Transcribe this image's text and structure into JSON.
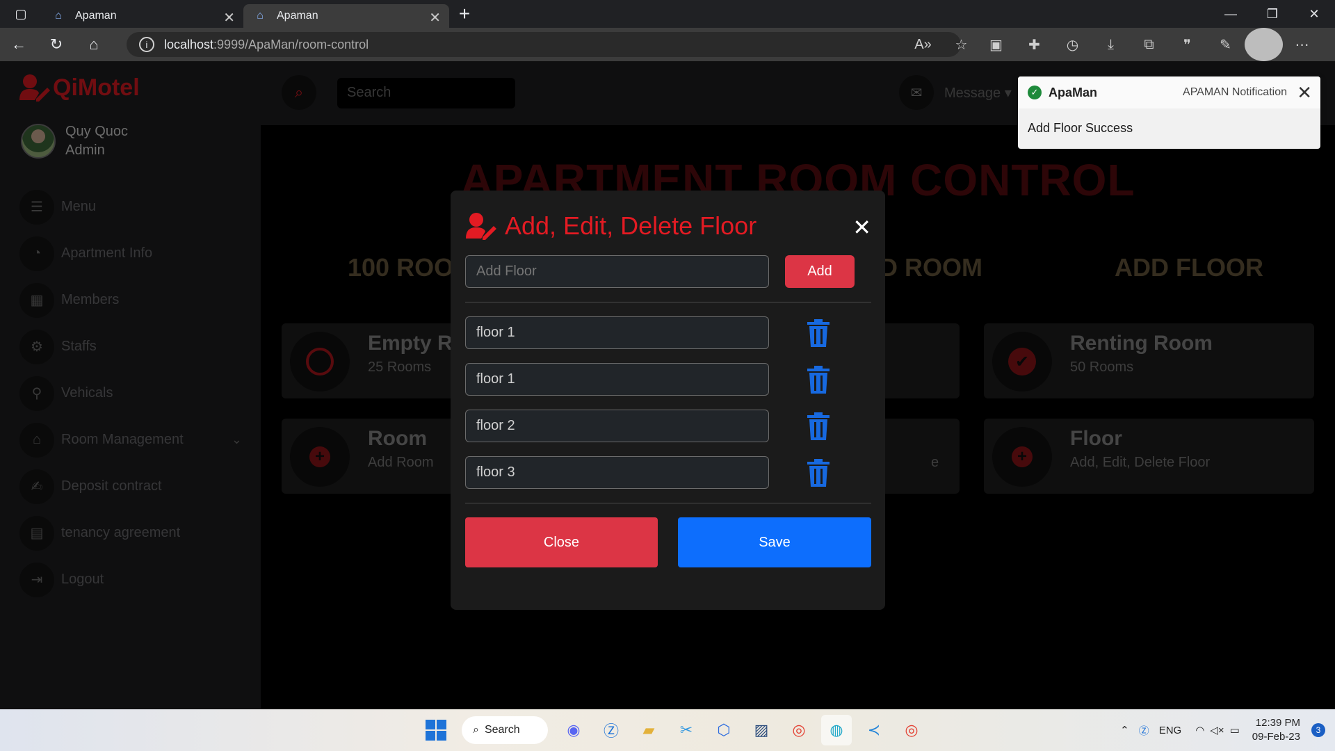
{
  "browser": {
    "tabs": [
      {
        "title": "Apaman",
        "active": false
      },
      {
        "title": "Apaman",
        "active": true
      }
    ],
    "url_host": "localhost",
    "url_rest": ":9999/ApaMan/room-control"
  },
  "app": {
    "logo": "QiMotel",
    "user": {
      "name": "Quy Quoc",
      "role": "Admin"
    },
    "menu": [
      {
        "label": "Menu",
        "icon": "list-icon"
      },
      {
        "label": "Apartment Info",
        "icon": "gauge-icon"
      },
      {
        "label": "Members",
        "icon": "table-icon"
      },
      {
        "label": "Staffs",
        "icon": "user-cog-icon"
      },
      {
        "label": "Vehicals",
        "icon": "bicycle-icon"
      },
      {
        "label": "Room Management",
        "icon": "home-icon"
      },
      {
        "label": "Deposit contract",
        "icon": "file-signature-icon"
      },
      {
        "label": "tenancy agreement",
        "icon": "file-icon"
      },
      {
        "label": "Logout",
        "icon": "logout-icon"
      }
    ],
    "search_placeholder": "Search",
    "message_label": "Message",
    "page_title": "APARTMENT ROOM CONTROL",
    "stats": [
      "100 ROOM",
      "D ROOM",
      "ADD FLOOR"
    ],
    "cards": [
      {
        "title": "Empty Ro",
        "sub": "25 Rooms"
      },
      {
        "title": "Renting Room",
        "sub": "50 Rooms"
      },
      {
        "title": "Room",
        "sub": "Add Room"
      },
      {
        "title": "",
        "sub": "e"
      },
      {
        "title": "Floor",
        "sub": "Add, Edit, Delete Floor"
      }
    ]
  },
  "modal": {
    "title": "Add, Edit, Delete Floor",
    "add_placeholder": "Add Floor",
    "add_label": "Add",
    "floors": [
      "floor 1",
      "floor 1",
      "floor 2",
      "floor 3"
    ],
    "close_label": "Close",
    "save_label": "Save"
  },
  "notification": {
    "app": "ApaMan",
    "source": "APAMAN Notification",
    "message": "Add Floor Success"
  },
  "taskbar": {
    "search_label": "Search",
    "lang": "ENG",
    "time": "12:39 PM",
    "date": "09-Feb-23",
    "badge": "3"
  },
  "colors": {
    "accent_red": "#e31b23",
    "danger": "#dc3545",
    "primary": "#0d6efd"
  }
}
